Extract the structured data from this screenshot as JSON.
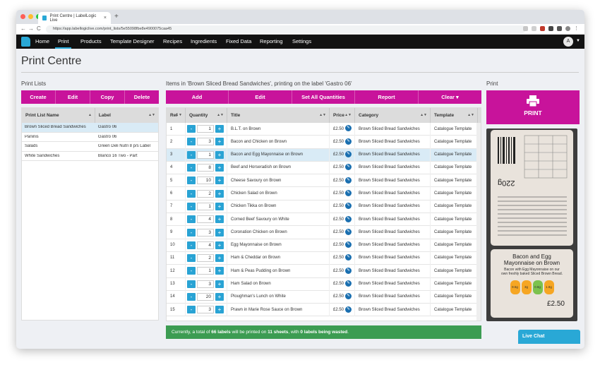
{
  "browser": {
    "tab_title": "Print Centre | LabelLogic Live",
    "tab_close": "×",
    "new_tab": "+",
    "url": "https://app.labellogiclive.com/print_lists/5e55098fbe8e4900075caa45",
    "back": "←",
    "forward": "→",
    "reload": "C"
  },
  "nav": {
    "items": [
      "Home",
      "Print",
      "Products",
      "Template Designer",
      "Recipes",
      "Ingredients",
      "Fixed Data",
      "Reporting",
      "Settings"
    ],
    "active": "Print",
    "avatar": "A"
  },
  "page": {
    "title": "Print Centre"
  },
  "print_lists": {
    "heading": "Print Lists",
    "actions": [
      "Create",
      "Edit",
      "Copy",
      "Delete"
    ],
    "columns": [
      "Print List Name",
      "Label"
    ],
    "rows": [
      {
        "name": "Brown Sliced Bread Sandwiches",
        "label": "Gastro 06",
        "selected": true
      },
      {
        "name": "Paninis",
        "label": "Gastro 06",
        "selected": false
      },
      {
        "name": "Salads",
        "label": "Green Deli Nutri 8 p/s Label",
        "selected": false
      },
      {
        "name": "White Sandwiches",
        "label": "Blanco 16 Two - Part",
        "selected": false
      }
    ]
  },
  "items": {
    "heading": "Items in 'Brown Sliced Bread Sandwiches', printing on the label 'Gastro 06'",
    "actions": [
      "Add",
      "Edit",
      "Set All Quantities",
      "Report",
      "Clear ▾"
    ],
    "columns": [
      "Ref",
      "Quantity",
      "Title",
      "Price",
      "Category",
      "Template"
    ],
    "minus": "-",
    "plus": "+",
    "rows": [
      {
        "ref": "1",
        "qty": "1",
        "title": "B.L.T. on Brown",
        "price": "£2.50",
        "category": "Brown Sliced Bread Sandwiches",
        "template": "Catalogue Template"
      },
      {
        "ref": "2",
        "qty": "3",
        "title": "Bacon and Chicken on Brown",
        "price": "£2.50",
        "category": "Brown Sliced Bread Sandwiches",
        "template": "Catalogue Template"
      },
      {
        "ref": "3",
        "qty": "1",
        "title": "Bacon and Egg Mayonnaise on Brown",
        "price": "£2.50",
        "category": "Brown Sliced Bread Sandwiches",
        "template": "Catalogue Template",
        "selected": true
      },
      {
        "ref": "4",
        "qty": "8",
        "title": "Beef and Horseradish on Brown",
        "price": "£2.50",
        "category": "Brown Sliced Bread Sandwiches",
        "template": "Catalogue Template"
      },
      {
        "ref": "5",
        "qty": "10",
        "title": "Cheese Savoury on Brown",
        "price": "£2.50",
        "category": "Brown Sliced Bread Sandwiches",
        "template": "Catalogue Template"
      },
      {
        "ref": "6",
        "qty": "2",
        "title": "Chicken Salad on Brown",
        "price": "£2.50",
        "category": "Brown Sliced Bread Sandwiches",
        "template": "Catalogue Template"
      },
      {
        "ref": "7",
        "qty": "1",
        "title": "Chicken Tikka on Brown",
        "price": "£2.50",
        "category": "Brown Sliced Bread Sandwiches",
        "template": "Catalogue Template"
      },
      {
        "ref": "8",
        "qty": "4",
        "title": "Corned Beef Savoury on White",
        "price": "£2.50",
        "category": "Brown Sliced Bread Sandwiches",
        "template": "Catalogue Template"
      },
      {
        "ref": "9",
        "qty": "3",
        "title": "Coronation Chicken on Brown",
        "price": "£2.50",
        "category": "Brown Sliced Bread Sandwiches",
        "template": "Catalogue Template"
      },
      {
        "ref": "10",
        "qty": "4",
        "title": "Egg Mayonnaise on Brown",
        "price": "£2.50",
        "category": "Brown Sliced Bread Sandwiches",
        "template": "Catalogue Template"
      },
      {
        "ref": "11",
        "qty": "2",
        "title": "Ham & Cheddar on Brown",
        "price": "£2.50",
        "category": "Brown Sliced Bread Sandwiches",
        "template": "Catalogue Template"
      },
      {
        "ref": "12",
        "qty": "1",
        "title": "Ham & Peas Pudding on Brown",
        "price": "£2.50",
        "category": "Brown Sliced Bread Sandwiches",
        "template": "Catalogue Template"
      },
      {
        "ref": "13",
        "qty": "3",
        "title": "Ham Salad on Brown",
        "price": "£2.50",
        "category": "Brown Sliced Bread Sandwiches",
        "template": "Catalogue Template"
      },
      {
        "ref": "14",
        "qty": "20",
        "title": "Ploughman's Lunch on White",
        "price": "£2.50",
        "category": "Brown Sliced Bread Sandwiches",
        "template": "Catalogue Template"
      },
      {
        "ref": "15",
        "qty": "3",
        "title": "Prawn in Marie Rose Sauce on Brown",
        "price": "£2.50",
        "category": "Brown Sliced Bread Sandwiches",
        "template": "Catalogue Template"
      }
    ],
    "status_prefix": "Currently, a total of",
    "status_labels": "66 labels",
    "status_mid": "will be printed on",
    "status_sheets": "11 sheets",
    "status_mid2": ", with",
    "status_wasted": "0 labels being wasted",
    "status_end": "."
  },
  "print_panel": {
    "heading": "Print",
    "button": "PRINT",
    "label_preview": {
      "weight": "220g",
      "title_line1": "Bacon and Egg",
      "title_line2": "Mayonnaise on Brown",
      "desc_line1": "Bacon with Egg Mayonnaise on our",
      "desc_line2": "own freshly baked Sliced Brown Bread.",
      "price": "£2.50",
      "nutri_values": [
        "9.5g",
        "3g",
        "0.8g",
        "1.8g"
      ]
    }
  },
  "live_chat": "Live Chat",
  "colors": {
    "accent_magenta": "#c8139b",
    "brand_blue": "#29a8d6",
    "status_green": "#3c9c52"
  }
}
